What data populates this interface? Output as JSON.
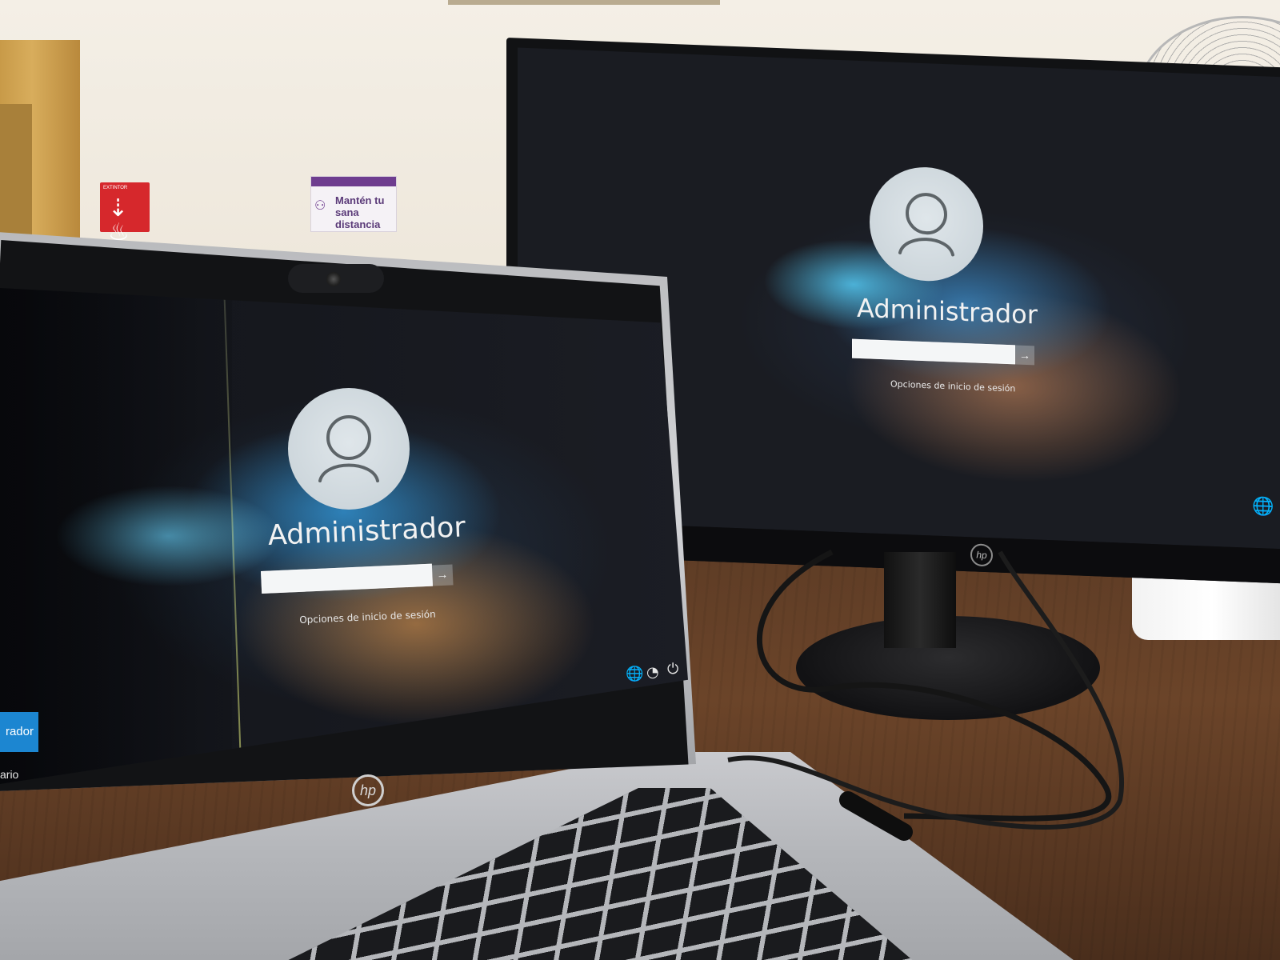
{
  "monitor_lock": {
    "username": "Administrador",
    "password_value": "",
    "submit_glyph": "→",
    "options_label": "Opciones de inicio de sesión",
    "network_glyph": "🌐"
  },
  "laptop_lock": {
    "username": "Administrador",
    "password_value": "",
    "submit_glyph": "→",
    "options_label": "Opciones de inicio de sesión",
    "network_glyph": "🌐",
    "accessibility_glyph": "◔",
    "power_glyph": "⏻",
    "user_tiles": [
      "rador",
      "ario"
    ]
  },
  "wall_signs": {
    "distance": "Mantén tu sana distancia",
    "distance_people_glyph": "⚇",
    "extinguisher_glyph": "⇣♨",
    "extinguisher_text": "EXTINTOR"
  },
  "brand": {
    "monitor_logo": "hp",
    "laptop_logo": "hp"
  },
  "colors": {
    "tile_accent": "#1c86d1",
    "sign_purple": "#6e3d8f",
    "sign_red": "#d6282c"
  }
}
